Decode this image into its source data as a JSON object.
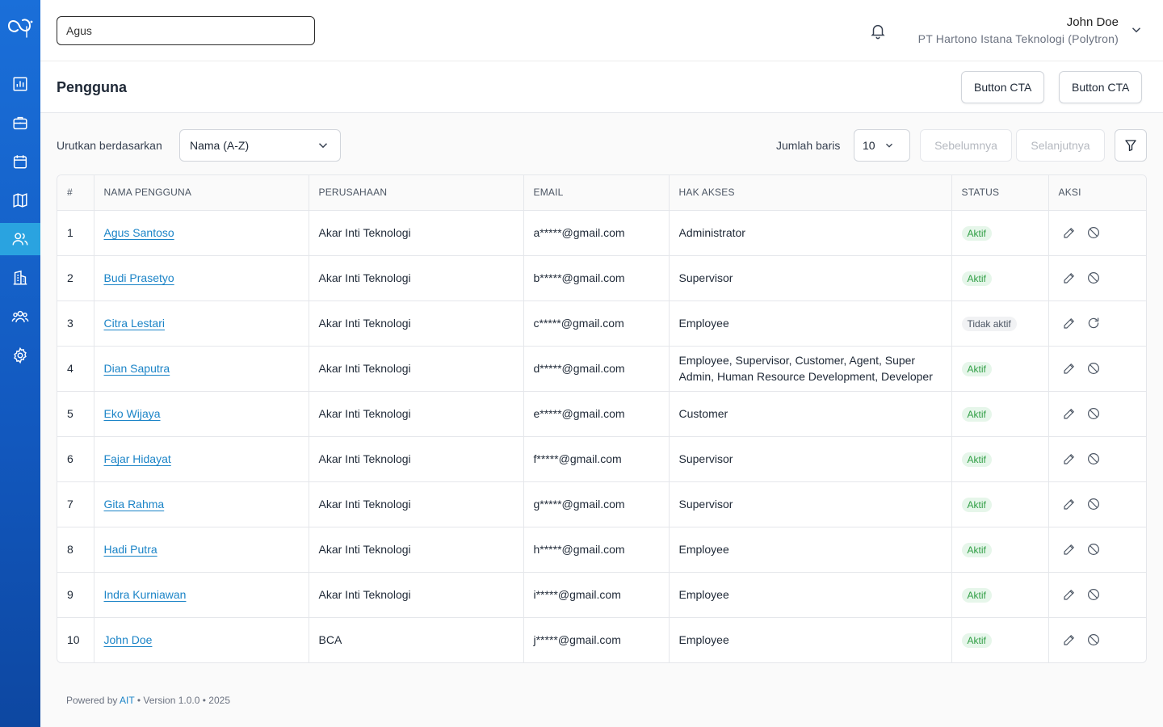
{
  "header": {
    "search_value": "Agus",
    "user_name": "John Doe",
    "user_company": "PT Hartono Istana Teknologi (Polytron)"
  },
  "page": {
    "title": "Pengguna",
    "cta_1": "Button CTA",
    "cta_2": "Button CTA"
  },
  "controls": {
    "sort_label": "Urutkan berdasarkan",
    "sort_value": "Nama (A-Z)",
    "rows_label": "Jumlah baris",
    "rows_value": "10",
    "prev_label": "Sebelumnya",
    "next_label": "Selanjutnya"
  },
  "table": {
    "headers": [
      "#",
      "NAMA PENGGUNA",
      "PERUSAHAAN",
      "EMAIL",
      "HAK AKSES",
      "STATUS",
      "AKSI"
    ],
    "rows": [
      {
        "no": "1",
        "name": "Agus Santoso",
        "company": "Akar Inti Teknologi",
        "email": "a*****@gmail.com",
        "access": "Administrator",
        "status": "Aktif",
        "active": true
      },
      {
        "no": "2",
        "name": "Budi Prasetyo",
        "company": "Akar Inti Teknologi",
        "email": "b*****@gmail.com",
        "access": "Supervisor",
        "status": "Aktif",
        "active": true
      },
      {
        "no": "3",
        "name": "Citra Lestari",
        "company": "Akar Inti Teknologi",
        "email": "c*****@gmail.com",
        "access": "Employee",
        "status": "Tidak aktif",
        "active": false
      },
      {
        "no": "4",
        "name": "Dian Saputra",
        "company": "Akar Inti Teknologi",
        "email": "d*****@gmail.com",
        "access": "Employee, Supervisor, Customer, Agent, Super Admin, Human Resource Development, Developer",
        "status": "Aktif",
        "active": true
      },
      {
        "no": "5",
        "name": "Eko Wijaya",
        "company": "Akar Inti Teknologi",
        "email": "e*****@gmail.com",
        "access": "Customer",
        "status": "Aktif",
        "active": true
      },
      {
        "no": "6",
        "name": "Fajar Hidayat",
        "company": "Akar Inti Teknologi",
        "email": "f*****@gmail.com",
        "access": "Supervisor",
        "status": "Aktif",
        "active": true
      },
      {
        "no": "7",
        "name": "Gita Rahma",
        "company": "Akar Inti Teknologi",
        "email": "g*****@gmail.com",
        "access": "Supervisor",
        "status": "Aktif",
        "active": true
      },
      {
        "no": "8",
        "name": "Hadi Putra",
        "company": "Akar Inti Teknologi",
        "email": "h*****@gmail.com",
        "access": "Employee",
        "status": "Aktif",
        "active": true
      },
      {
        "no": "9",
        "name": "Indra Kurniawan",
        "company": "Akar Inti Teknologi",
        "email": "i*****@gmail.com",
        "access": "Employee",
        "status": "Aktif",
        "active": true
      },
      {
        "no": "10",
        "name": "John Doe",
        "company": "BCA",
        "email": "j*****@gmail.com",
        "access": "Employee",
        "status": "Aktif",
        "active": true
      }
    ]
  },
  "footer": {
    "powered_by": "Powered by",
    "brand": "AIT",
    "version": "• Version 1.0.0 • 2025"
  },
  "icons": {
    "sidebar": [
      "dashboard-icon",
      "briefcase-icon",
      "calendar-icon",
      "map-icon",
      "users-icon",
      "building-icon",
      "team-icon",
      "settings-icon"
    ],
    "active_sidebar": "users-icon"
  },
  "colors": {
    "sidebar": "#1a6fd9",
    "sidebar_active": "#2aa3e0",
    "link": "#1b84c7",
    "badge_active_bg": "#e6f6ea",
    "badge_active_text": "#2f9e44"
  }
}
